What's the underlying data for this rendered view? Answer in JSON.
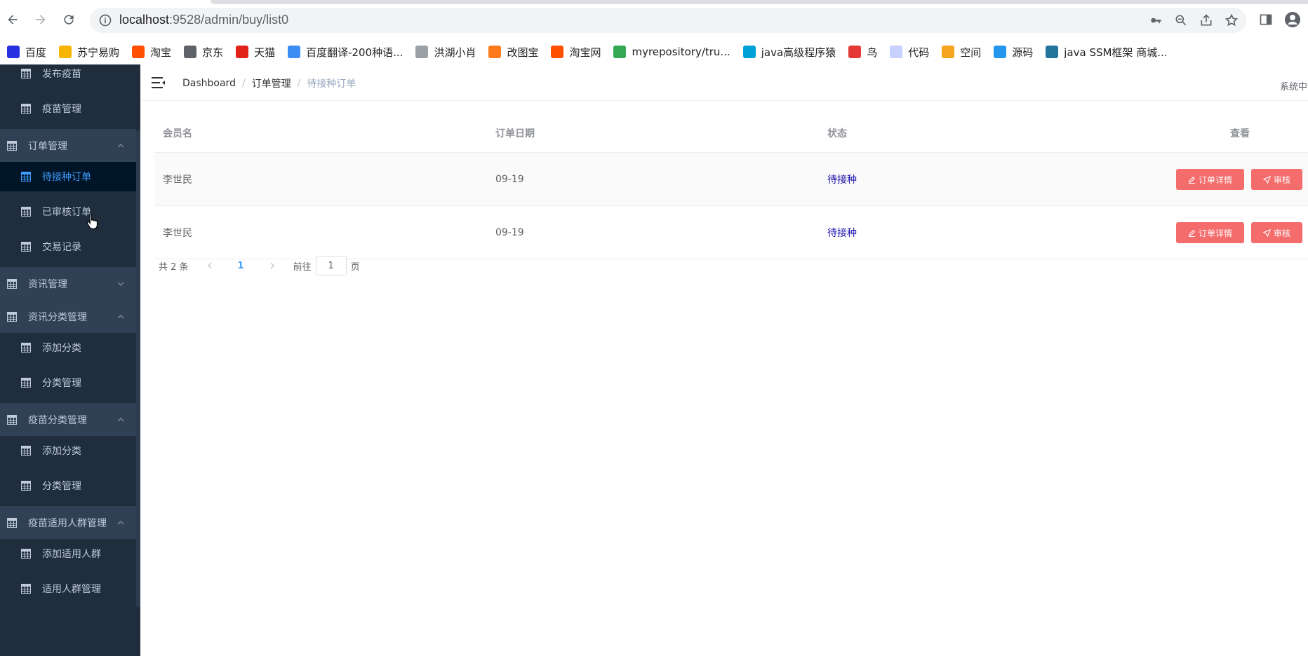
{
  "browser": {
    "url_host": "localhost",
    "url_path": ":9528/admin/buy/list0",
    "bookmarks": [
      {
        "label": "百度",
        "color": "#2932e1"
      },
      {
        "label": "苏宁易购",
        "color": "#f7b500"
      },
      {
        "label": "淘宝",
        "color": "#ff5000"
      },
      {
        "label": "京东",
        "color": "#5f6368"
      },
      {
        "label": "天猫",
        "color": "#e2231a"
      },
      {
        "label": "百度翻译-200种语...",
        "color": "#3b8cf3"
      },
      {
        "label": "洪湖小肖",
        "color": "#9aa0a6"
      },
      {
        "label": "改图宝",
        "color": "#ff7a1a"
      },
      {
        "label": "淘宝网",
        "color": "#ff5000"
      },
      {
        "label": "myrepository/tru...",
        "color": "#34a853"
      },
      {
        "label": "java高级程序猿",
        "color": "#00a1d6"
      },
      {
        "label": "鸟",
        "color": "#e53935"
      },
      {
        "label": "代码",
        "color": "#c8d0ff"
      },
      {
        "label": "空间",
        "color": "#f4a41d"
      },
      {
        "label": "源码",
        "color": "#2496ed"
      },
      {
        "label": "java SSM框架 商城...",
        "color": "#21759b"
      }
    ]
  },
  "sidebar": {
    "items": [
      {
        "label": "发布疫苗",
        "type": "child"
      },
      {
        "label": "疫苗管理",
        "type": "child"
      },
      {
        "label": "订单管理",
        "type": "parent",
        "chevron": "up"
      },
      {
        "label": "待接种订单",
        "type": "child",
        "active": true
      },
      {
        "label": "已审核订单",
        "type": "child"
      },
      {
        "label": "交易记录",
        "type": "child"
      },
      {
        "label": "资讯管理",
        "type": "parent",
        "chevron": "down"
      },
      {
        "label": "资讯分类管理",
        "type": "parent",
        "chevron": "up"
      },
      {
        "label": "添加分类",
        "type": "child"
      },
      {
        "label": "分类管理",
        "type": "child"
      },
      {
        "label": "疫苗分类管理",
        "type": "parent",
        "chevron": "up"
      },
      {
        "label": "添加分类",
        "type": "child"
      },
      {
        "label": "分类管理",
        "type": "child"
      },
      {
        "label": "疫苗适用人群管理",
        "type": "parent",
        "chevron": "up"
      },
      {
        "label": "添加适用人群",
        "type": "child"
      },
      {
        "label": "适用人群管理",
        "type": "child"
      }
    ]
  },
  "navbar": {
    "breadcrumb": [
      "Dashboard",
      "订单管理",
      "待接种订单"
    ],
    "right_text": "系统中"
  },
  "table": {
    "headers": [
      "会员名",
      "订单日期",
      "状态",
      "查看"
    ],
    "rows": [
      {
        "member": "李世民",
        "date": "09-19",
        "status": "待接种"
      },
      {
        "member": "李世民",
        "date": "09-19",
        "status": "待接种"
      }
    ],
    "detail_label": "订单详情",
    "audit_label": "审核"
  },
  "pagination": {
    "total": "共 2 条",
    "current": "1",
    "goto_prefix": "前往",
    "goto_value": "1",
    "goto_suffix": "页"
  },
  "colors": {
    "sidebar_bg": "#1f2d3d",
    "sidebar_parent_bg": "#304156",
    "active_text": "#409eff",
    "button_danger": "#f56c6c",
    "status_text": "#1a0dab"
  }
}
